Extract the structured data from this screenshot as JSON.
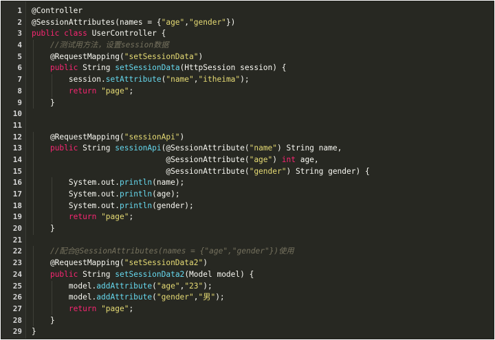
{
  "editor": {
    "lines": [
      {
        "n": "1",
        "tokens": [
          {
            "t": "@Controller",
            "c": "pl"
          }
        ]
      },
      {
        "n": "2",
        "tokens": [
          {
            "t": "@SessionAttributes(names = {",
            "c": "pl"
          },
          {
            "t": "\"age\"",
            "c": "str"
          },
          {
            "t": ",",
            "c": "pl"
          },
          {
            "t": "\"gender\"",
            "c": "str"
          },
          {
            "t": "})",
            "c": "pl"
          }
        ]
      },
      {
        "n": "3",
        "tokens": [
          {
            "t": "public",
            "c": "kw"
          },
          {
            "t": " ",
            "c": "pl"
          },
          {
            "t": "class",
            "c": "kw"
          },
          {
            "t": " UserController {",
            "c": "pl"
          }
        ]
      },
      {
        "n": "4",
        "tokens": [
          {
            "t": "    ",
            "c": "pl"
          },
          {
            "t": "//测试用方法，设置session数据",
            "c": "cm"
          }
        ]
      },
      {
        "n": "5",
        "tokens": [
          {
            "t": "    @RequestMapping(",
            "c": "pl"
          },
          {
            "t": "\"setSessionData\"",
            "c": "str"
          },
          {
            "t": ")",
            "c": "pl"
          }
        ]
      },
      {
        "n": "6",
        "tokens": [
          {
            "t": "    ",
            "c": "pl"
          },
          {
            "t": "public",
            "c": "kw"
          },
          {
            "t": " String ",
            "c": "pl"
          },
          {
            "t": "setSessionData",
            "c": "fn"
          },
          {
            "t": "(HttpSession session) {",
            "c": "pl"
          }
        ]
      },
      {
        "n": "7",
        "tokens": [
          {
            "t": "        session.",
            "c": "pl"
          },
          {
            "t": "setAttribute",
            "c": "fn"
          },
          {
            "t": "(",
            "c": "pl"
          },
          {
            "t": "\"name\"",
            "c": "str"
          },
          {
            "t": ",",
            "c": "pl"
          },
          {
            "t": "\"itheima\"",
            "c": "str"
          },
          {
            "t": ");",
            "c": "pl"
          }
        ]
      },
      {
        "n": "8",
        "tokens": [
          {
            "t": "        ",
            "c": "pl"
          },
          {
            "t": "return",
            "c": "kw"
          },
          {
            "t": " ",
            "c": "pl"
          },
          {
            "t": "\"page\"",
            "c": "str"
          },
          {
            "t": ";",
            "c": "pl"
          }
        ]
      },
      {
        "n": "9",
        "tokens": [
          {
            "t": "    }",
            "c": "pl"
          }
        ]
      },
      {
        "n": "10",
        "tokens": []
      },
      {
        "n": "11",
        "tokens": []
      },
      {
        "n": "12",
        "tokens": [
          {
            "t": "    @RequestMapping(",
            "c": "pl"
          },
          {
            "t": "\"sessionApi\"",
            "c": "str"
          },
          {
            "t": ")",
            "c": "pl"
          }
        ]
      },
      {
        "n": "13",
        "tokens": [
          {
            "t": "    ",
            "c": "pl"
          },
          {
            "t": "public",
            "c": "kw"
          },
          {
            "t": " String ",
            "c": "pl"
          },
          {
            "t": "sessionApi",
            "c": "fn"
          },
          {
            "t": "(@SessionAttribute(",
            "c": "pl"
          },
          {
            "t": "\"name\"",
            "c": "str"
          },
          {
            "t": ") String name,",
            "c": "pl"
          }
        ]
      },
      {
        "n": "14",
        "tokens": [
          {
            "t": "                             @SessionAttribute(",
            "c": "pl"
          },
          {
            "t": "\"age\"",
            "c": "str"
          },
          {
            "t": ") ",
            "c": "pl"
          },
          {
            "t": "int",
            "c": "kw"
          },
          {
            "t": " age,",
            "c": "pl"
          }
        ]
      },
      {
        "n": "15",
        "tokens": [
          {
            "t": "                             @SessionAttribute(",
            "c": "pl"
          },
          {
            "t": "\"gender\"",
            "c": "str"
          },
          {
            "t": ") String gender) {",
            "c": "pl"
          }
        ]
      },
      {
        "n": "16",
        "tokens": [
          {
            "t": "        System.out.",
            "c": "pl"
          },
          {
            "t": "println",
            "c": "fn"
          },
          {
            "t": "(name);",
            "c": "pl"
          }
        ]
      },
      {
        "n": "17",
        "tokens": [
          {
            "t": "        System.out.",
            "c": "pl"
          },
          {
            "t": "println",
            "c": "fn"
          },
          {
            "t": "(age);",
            "c": "pl"
          }
        ]
      },
      {
        "n": "18",
        "tokens": [
          {
            "t": "        System.out.",
            "c": "pl"
          },
          {
            "t": "println",
            "c": "fn"
          },
          {
            "t": "(gender);",
            "c": "pl"
          }
        ]
      },
      {
        "n": "19",
        "tokens": [
          {
            "t": "        ",
            "c": "pl"
          },
          {
            "t": "return",
            "c": "kw"
          },
          {
            "t": " ",
            "c": "pl"
          },
          {
            "t": "\"page\"",
            "c": "str"
          },
          {
            "t": ";",
            "c": "pl"
          }
        ]
      },
      {
        "n": "20",
        "tokens": [
          {
            "t": "    }",
            "c": "pl"
          }
        ]
      },
      {
        "n": "21",
        "tokens": []
      },
      {
        "n": "22",
        "tokens": [
          {
            "t": "    ",
            "c": "pl"
          },
          {
            "t": "//配合@SessionAttributes(names = {\"age\",\"gender\"})使用",
            "c": "cm"
          }
        ]
      },
      {
        "n": "23",
        "tokens": [
          {
            "t": "    @RequestMapping(",
            "c": "pl"
          },
          {
            "t": "\"setSessionData2\"",
            "c": "str"
          },
          {
            "t": ")",
            "c": "pl"
          }
        ]
      },
      {
        "n": "24",
        "tokens": [
          {
            "t": "    ",
            "c": "pl"
          },
          {
            "t": "public",
            "c": "kw"
          },
          {
            "t": " String ",
            "c": "pl"
          },
          {
            "t": "setSessionData2",
            "c": "fn"
          },
          {
            "t": "(Model model) {",
            "c": "pl"
          }
        ]
      },
      {
        "n": "25",
        "tokens": [
          {
            "t": "        model.",
            "c": "pl"
          },
          {
            "t": "addAttribute",
            "c": "fn"
          },
          {
            "t": "(",
            "c": "pl"
          },
          {
            "t": "\"age\"",
            "c": "str"
          },
          {
            "t": ",",
            "c": "pl"
          },
          {
            "t": "\"23\"",
            "c": "str"
          },
          {
            "t": ");",
            "c": "pl"
          }
        ]
      },
      {
        "n": "26",
        "tokens": [
          {
            "t": "        model.",
            "c": "pl"
          },
          {
            "t": "addAttribute",
            "c": "fn"
          },
          {
            "t": "(",
            "c": "pl"
          },
          {
            "t": "\"gender\"",
            "c": "str"
          },
          {
            "t": ",",
            "c": "pl"
          },
          {
            "t": "\"男\"",
            "c": "str"
          },
          {
            "t": ");",
            "c": "pl"
          }
        ]
      },
      {
        "n": "27",
        "tokens": [
          {
            "t": "        ",
            "c": "pl"
          },
          {
            "t": "return",
            "c": "kw"
          },
          {
            "t": " ",
            "c": "pl"
          },
          {
            "t": "\"page\"",
            "c": "str"
          },
          {
            "t": ";",
            "c": "pl"
          }
        ]
      },
      {
        "n": "28",
        "tokens": [
          {
            "t": "    }",
            "c": "pl"
          }
        ]
      },
      {
        "n": "29",
        "tokens": [
          {
            "t": "}",
            "c": "pl"
          }
        ]
      }
    ]
  },
  "colors": {
    "background": "#272822",
    "keyword": "#f92672",
    "string": "#e6db74",
    "function": "#66d9ef",
    "comment": "#75715e",
    "plain": "#f8f8f2"
  }
}
